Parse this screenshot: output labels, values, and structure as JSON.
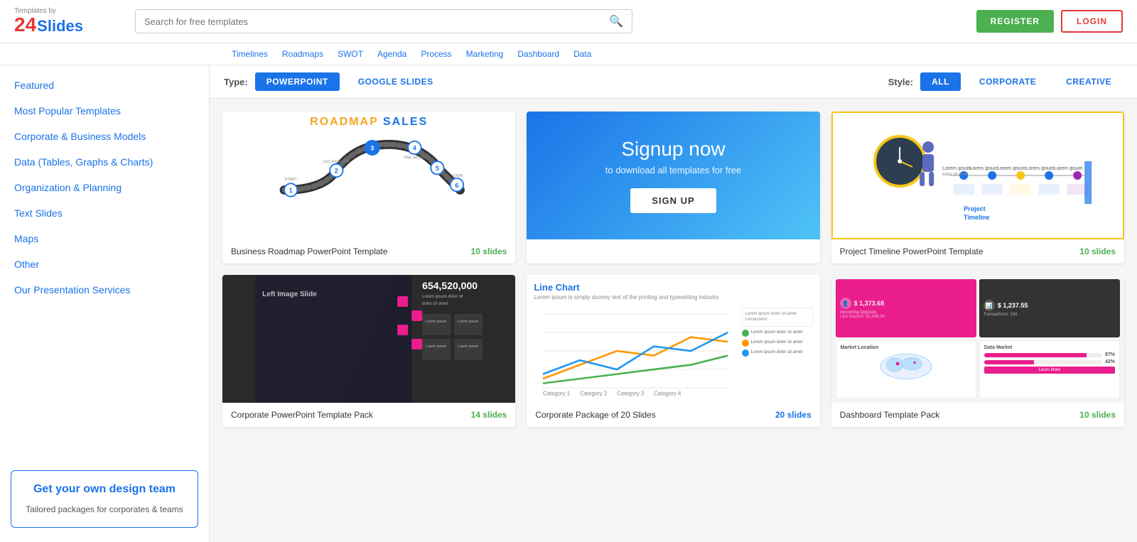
{
  "app": {
    "name": "Templates by 24Slides",
    "logo_24": "24",
    "logo_slides": "Slides",
    "logo_by": "Templates by"
  },
  "header": {
    "search_placeholder": "Search for free templates",
    "register_label": "REGISTER",
    "login_label": "LOGIN"
  },
  "tags": [
    "Timelines",
    "Roadmaps",
    "SWOT",
    "Agenda",
    "Process",
    "Marketing",
    "Dashboard",
    "Data"
  ],
  "filter": {
    "type_label": "Type:",
    "style_label": "Style:",
    "type_options": [
      {
        "label": "POWERPOINT",
        "active": true
      },
      {
        "label": "GOOGLE SLIDES",
        "active": false
      }
    ],
    "style_options": [
      {
        "label": "ALL",
        "active": true
      },
      {
        "label": "CORPORATE",
        "active": false
      },
      {
        "label": "CREATIVE",
        "active": false
      }
    ]
  },
  "sidebar": {
    "links": [
      {
        "label": "Featured",
        "active": false
      },
      {
        "label": "Most Popular Templates",
        "active": false
      },
      {
        "label": "Corporate & Business Models",
        "active": false
      },
      {
        "label": "Data (Tables, Graphs & Charts)",
        "active": false
      },
      {
        "label": "Organization & Planning",
        "active": false
      },
      {
        "label": "Text Slides",
        "active": false
      },
      {
        "label": "Maps",
        "active": false
      },
      {
        "label": "Other",
        "active": false
      },
      {
        "label": "Our Presentation Services",
        "active": false
      }
    ],
    "promo": {
      "title": "Get your own design team",
      "subtitle": "Tailored packages for corporates & teams"
    }
  },
  "cards": [
    {
      "id": "roadmap",
      "title": "Business Roadmap PowerPoint Template",
      "slides": "10 slides",
      "slides_color": "green",
      "type": "roadmap"
    },
    {
      "id": "signup",
      "type": "signup",
      "title": "Signup now",
      "subtitle": "to download all templates for free",
      "btn_label": "SIGN UP"
    },
    {
      "id": "timeline",
      "title": "Project Timeline PowerPoint Template",
      "slides": "10 slides",
      "slides_color": "green",
      "type": "timeline"
    },
    {
      "id": "corporate-pack",
      "title": "Corporate PowerPoint Template Pack",
      "slides": "14 slides",
      "slides_color": "green",
      "type": "corporate"
    },
    {
      "id": "corporate-package",
      "title": "Corporate Package of 20 Slides",
      "slides": "20 slides",
      "slides_color": "blue",
      "type": "linechart"
    },
    {
      "id": "dashboard",
      "title": "Dashboard Template Pack",
      "slides": "10 slides",
      "slides_color": "green",
      "type": "dashboard"
    }
  ]
}
